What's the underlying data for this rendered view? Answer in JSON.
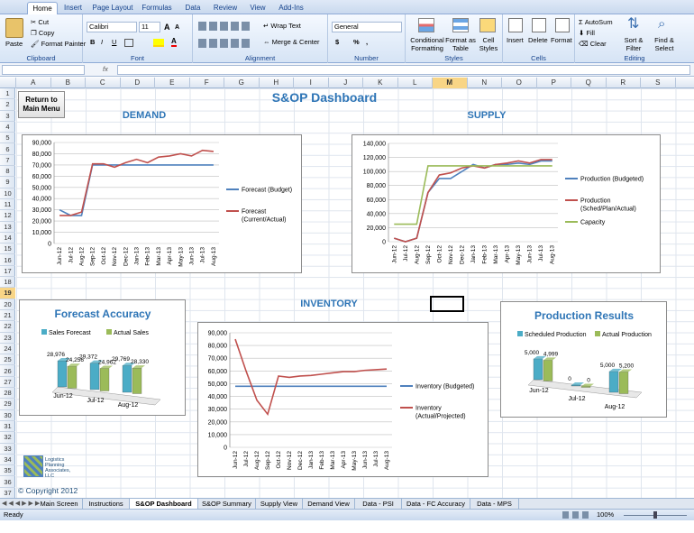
{
  "ribbon": {
    "tabs": [
      "Home",
      "Insert",
      "Page Layout",
      "Formulas",
      "Data",
      "Review",
      "View",
      "Add-Ins"
    ],
    "clipboard": {
      "paste": "Paste",
      "cut": "Cut",
      "copy": "Copy",
      "format_painter": "Format Painter",
      "label": "Clipboard"
    },
    "font": {
      "name": "Calibri",
      "size": "11",
      "label": "Font",
      "bold": "B",
      "italic": "I",
      "underline": "U",
      "grow": "A",
      "shrink": "A"
    },
    "alignment": {
      "wrap": "Wrap Text",
      "merge": "Merge & Center",
      "label": "Alignment"
    },
    "number": {
      "format": "General",
      "currency": "$",
      "percent": "%",
      "comma": ",",
      "label": "Number"
    },
    "styles": {
      "cond": "Conditional Formatting",
      "table": "Format as Table",
      "cell": "Cell Styles",
      "label": "Styles"
    },
    "cells": {
      "insert": "Insert",
      "delete": "Delete",
      "format": "Format",
      "label": "Cells"
    },
    "editing": {
      "autosum": "AutoSum",
      "fill": "Fill",
      "clear": "Clear",
      "sort": "Sort & Filter",
      "find": "Find & Select",
      "label": "Editing"
    }
  },
  "formula_bar": {
    "fx": "fx",
    "value": ""
  },
  "columns": [
    "A",
    "B",
    "C",
    "D",
    "E",
    "F",
    "G",
    "H",
    "I",
    "J",
    "K",
    "L",
    "M",
    "N",
    "O",
    "P",
    "Q",
    "R",
    "S"
  ],
  "selected_column": "M",
  "rows": [
    "1",
    "2",
    "3",
    "4",
    "5",
    "6",
    "7",
    "8",
    "9",
    "10",
    "11",
    "12",
    "13",
    "14",
    "15",
    "16",
    "17",
    "18",
    "19",
    "20",
    "21",
    "22",
    "23",
    "24",
    "25",
    "26",
    "27",
    "28",
    "29",
    "30",
    "31",
    "32",
    "33",
    "34",
    "35",
    "36",
    "37"
  ],
  "selected_row": "19",
  "sheet": {
    "title": "S&OP Dashboard",
    "return_button": "Return to Main Menu",
    "demand_header": "DEMAND",
    "supply_header": "SUPPLY",
    "inventory_header": "INVENTORY",
    "copyright": "© Copyright 2012",
    "logo_text": "Logistics Planning Associates, LLC"
  },
  "chart_data": [
    {
      "type": "line",
      "id": "demand",
      "months": [
        "Jun-12",
        "Jul-12",
        "Aug-12",
        "Sep-12",
        "Oct-12",
        "Nov-12",
        "Dec-12",
        "Jan-13",
        "Feb-13",
        "Mar-13",
        "Apr-13",
        "May-13",
        "Jun-13",
        "Jul-13",
        "Aug-13"
      ],
      "ylim": [
        0,
        90000
      ],
      "yticks": [
        "0",
        "10,000",
        "20,000",
        "30,000",
        "40,000",
        "50,000",
        "60,000",
        "70,000",
        "80,000",
        "90,000"
      ],
      "series": [
        {
          "name": "Forecast (Budget)",
          "color": "#4f81bd",
          "values": [
            30000,
            25000,
            25000,
            70000,
            70000,
            70000,
            70000,
            70000,
            70000,
            70000,
            70000,
            70000,
            70000,
            70000,
            70000
          ]
        },
        {
          "name": "Forecast (Current/Actual)",
          "color": "#c0504d",
          "values": [
            25000,
            25000,
            28000,
            71000,
            71000,
            68000,
            72000,
            75000,
            72000,
            77000,
            78000,
            80000,
            78000,
            83000,
            82000
          ]
        }
      ]
    },
    {
      "type": "line",
      "id": "supply",
      "months": [
        "Jun-12",
        "Jul-12",
        "Aug-12",
        "Sep-12",
        "Oct-12",
        "Nov-12",
        "Dec-12",
        "Jan-13",
        "Feb-13",
        "Mar-13",
        "Apr-13",
        "May-13",
        "Jun-13",
        "Jul-13",
        "Aug-13"
      ],
      "ylim": [
        0,
        140000
      ],
      "yticks": [
        "0",
        "20,000",
        "40,000",
        "60,000",
        "80,000",
        "100,000",
        "120,000",
        "140,000"
      ],
      "series": [
        {
          "name": "Production (Budgeted)",
          "color": "#4f81bd",
          "values": [
            5000,
            0,
            5000,
            70000,
            90000,
            90000,
            100000,
            110000,
            105000,
            110000,
            110000,
            112000,
            110000,
            115000,
            115000
          ]
        },
        {
          "name": "Production (Sched/Plan/Actual)",
          "color": "#c0504d",
          "values": [
            5000,
            0,
            5000,
            70000,
            95000,
            98000,
            105000,
            108000,
            105000,
            110000,
            112000,
            115000,
            112000,
            117000,
            117000
          ]
        },
        {
          "name": "Capacity",
          "color": "#9bbb59",
          "values": [
            25000,
            25000,
            25000,
            108000,
            108000,
            108000,
            108000,
            108000,
            108000,
            108000,
            108000,
            108000,
            108000,
            108000,
            108000
          ]
        }
      ]
    },
    {
      "type": "line",
      "id": "inventory",
      "months": [
        "Jun-12",
        "Jul-12",
        "Aug-12",
        "Sep-12",
        "Oct-12",
        "Nov-12",
        "Dec-12",
        "Jan-13",
        "Feb-13",
        "Mar-13",
        "Apr-13",
        "May-13",
        "Jun-13",
        "Jul-13",
        "Aug-13"
      ],
      "ylim": [
        0,
        90000
      ],
      "yticks": [
        "0",
        "10,000",
        "20,000",
        "30,000",
        "40,000",
        "50,000",
        "60,000",
        "70,000",
        "80,000",
        "90,000"
      ],
      "series": [
        {
          "name": "Inventory (Budgeted)",
          "color": "#4f81bd",
          "values": [
            48000,
            48000,
            48000,
            48000,
            48000,
            48000,
            48000,
            48000,
            48000,
            48000,
            48000,
            48000,
            48000,
            48000,
            48000
          ]
        },
        {
          "name": "Inventory (Actual/Projected)",
          "color": "#c0504d",
          "values": [
            85000,
            60000,
            37000,
            26000,
            56000,
            55000,
            56000,
            56500,
            57500,
            58500,
            59500,
            59500,
            60500,
            61000,
            61500
          ]
        }
      ]
    },
    {
      "type": "bar",
      "id": "accuracy",
      "title": "Forecast Accuracy",
      "categories": [
        "Jun-12",
        "Jul-12",
        "Aug-12"
      ],
      "series": [
        {
          "name": "Sales Forecast",
          "color": "#4bacc6",
          "values": [
            28976,
            29372,
            29769
          ],
          "labels": [
            "28,976",
            "29,372",
            "29,769"
          ]
        },
        {
          "name": "Actual Sales",
          "color": "#9bbb59",
          "values": [
            24256,
            24962,
            28330
          ],
          "labels": [
            "24,256",
            "24,962",
            "28,330"
          ]
        }
      ]
    },
    {
      "type": "bar",
      "id": "production",
      "title": "Production Results",
      "categories": [
        "Jun-12",
        "Jul-12",
        "Aug-12"
      ],
      "series": [
        {
          "name": "Scheduled Production",
          "color": "#4bacc6",
          "values": [
            5000,
            0,
            5000
          ],
          "labels": [
            "5,000",
            "0",
            "5,000"
          ]
        },
        {
          "name": "Actual Production",
          "color": "#9bbb59",
          "values": [
            4999,
            0,
            5200
          ],
          "labels": [
            "4,999",
            "0",
            "5,200"
          ]
        }
      ]
    }
  ],
  "sheet_tabs": [
    "Main Screen",
    "Instructions",
    "S&OP Dashboard",
    "S&OP Summary",
    "Supply View",
    "Demand View",
    "Data - PSI",
    "Data - FC Accuracy",
    "Data - MPS"
  ],
  "active_sheet": "S&OP Dashboard",
  "status": {
    "ready": "Ready",
    "zoom": "100%"
  }
}
